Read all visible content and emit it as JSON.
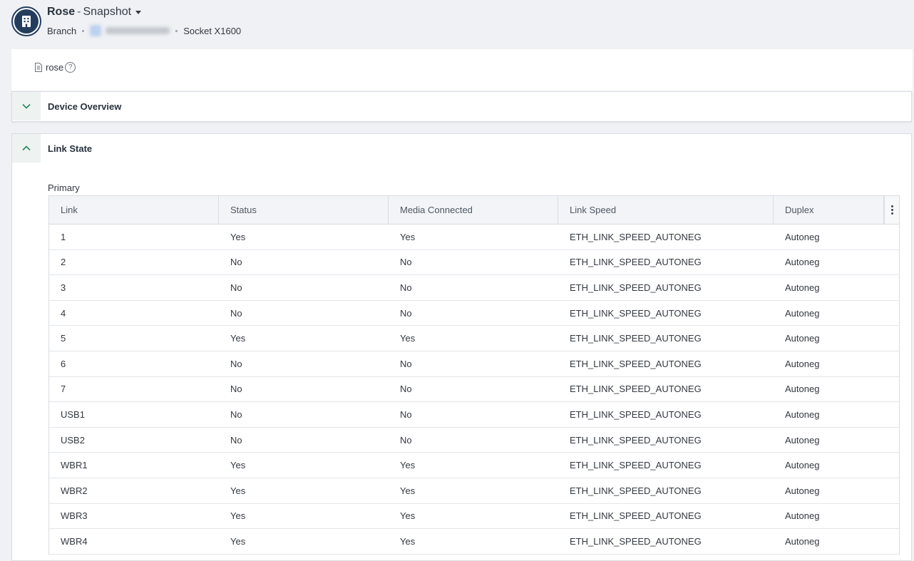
{
  "header": {
    "site_name": "Rose",
    "separator": "-",
    "view_name": "Snapshot",
    "breadcrumb_type": "Branch",
    "device_model": "Socket X1600"
  },
  "name_card": {
    "name": "rose",
    "help": "?"
  },
  "sections": {
    "overview_title": "Device Overview",
    "link_title": "Link State"
  },
  "link_state": {
    "group_label": "Primary",
    "columns": [
      "Link",
      "Status",
      "Media Connected",
      "Link Speed",
      "Duplex"
    ],
    "rows": [
      [
        "1",
        "Yes",
        "Yes",
        "ETH_LINK_SPEED_AUTONEG",
        "Autoneg"
      ],
      [
        "2",
        "No",
        "No",
        "ETH_LINK_SPEED_AUTONEG",
        "Autoneg"
      ],
      [
        "3",
        "No",
        "No",
        "ETH_LINK_SPEED_AUTONEG",
        "Autoneg"
      ],
      [
        "4",
        "No",
        "No",
        "ETH_LINK_SPEED_AUTONEG",
        "Autoneg"
      ],
      [
        "5",
        "Yes",
        "Yes",
        "ETH_LINK_SPEED_AUTONEG",
        "Autoneg"
      ],
      [
        "6",
        "No",
        "No",
        "ETH_LINK_SPEED_AUTONEG",
        "Autoneg"
      ],
      [
        "7",
        "No",
        "No",
        "ETH_LINK_SPEED_AUTONEG",
        "Autoneg"
      ],
      [
        "USB1",
        "No",
        "No",
        "ETH_LINK_SPEED_AUTONEG",
        "Autoneg"
      ],
      [
        "USB2",
        "No",
        "No",
        "ETH_LINK_SPEED_AUTONEG",
        "Autoneg"
      ],
      [
        "WBR1",
        "Yes",
        "Yes",
        "ETH_LINK_SPEED_AUTONEG",
        "Autoneg"
      ],
      [
        "WBR2",
        "Yes",
        "Yes",
        "ETH_LINK_SPEED_AUTONEG",
        "Autoneg"
      ],
      [
        "WBR3",
        "Yes",
        "Yes",
        "ETH_LINK_SPEED_AUTONEG",
        "Autoneg"
      ],
      [
        "WBR4",
        "Yes",
        "Yes",
        "ETH_LINK_SPEED_AUTONEG",
        "Autoneg"
      ]
    ]
  },
  "icons": {
    "site": "building-icon",
    "name": "document-icon",
    "expand": "chevron-down-icon",
    "collapse": "chevron-up-icon",
    "menu": "kebab-menu-icon"
  },
  "colors": {
    "accent": "#1f8a5b",
    "avatar": "#243d5c"
  }
}
